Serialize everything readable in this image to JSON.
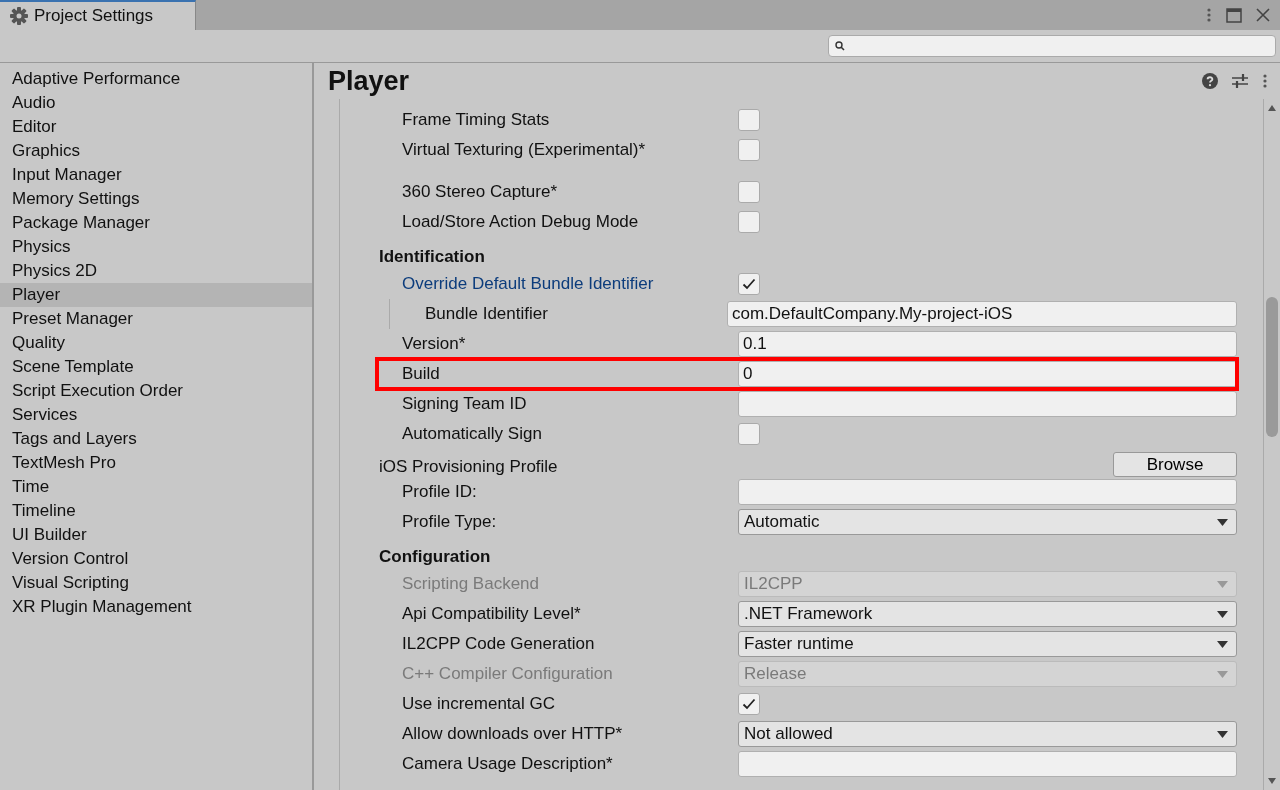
{
  "window": {
    "tab": {
      "title": "Project Settings",
      "selected": true
    }
  },
  "sidebar": {
    "items": [
      {
        "label": "Adaptive Performance",
        "selected": false
      },
      {
        "label": "Audio",
        "selected": false
      },
      {
        "label": "Editor",
        "selected": false
      },
      {
        "label": "Graphics",
        "selected": false
      },
      {
        "label": "Input Manager",
        "selected": false
      },
      {
        "label": "Memory Settings",
        "selected": false
      },
      {
        "label": "Package Manager",
        "selected": false
      },
      {
        "label": "Physics",
        "selected": false
      },
      {
        "label": "Physics 2D",
        "selected": false
      },
      {
        "label": "Player",
        "selected": true
      },
      {
        "label": "Preset Manager",
        "selected": false
      },
      {
        "label": "Quality",
        "selected": false
      },
      {
        "label": "Scene Template",
        "selected": false
      },
      {
        "label": "Script Execution Order",
        "selected": false
      },
      {
        "label": "Services",
        "selected": false
      },
      {
        "label": "Tags and Layers",
        "selected": false
      },
      {
        "label": "TextMesh Pro",
        "selected": false
      },
      {
        "label": "Time",
        "selected": false
      },
      {
        "label": "Timeline",
        "selected": false
      },
      {
        "label": "UI Builder",
        "selected": false
      },
      {
        "label": "Version Control",
        "selected": false
      },
      {
        "label": "Visual Scripting",
        "selected": false
      },
      {
        "label": "XR Plugin Management",
        "selected": false
      }
    ]
  },
  "panel": {
    "title": "Player",
    "rows": [
      {
        "kind": "checkbox",
        "label": "Frame Timing Stats",
        "checked": false
      },
      {
        "kind": "checkbox",
        "label": "Virtual Texturing (Experimental)*",
        "checked": false
      },
      {
        "kind": "spacer"
      },
      {
        "kind": "checkbox",
        "label": "360 Stereo Capture*",
        "checked": false
      },
      {
        "kind": "checkbox",
        "label": "Load/Store Action Debug Mode",
        "checked": false
      },
      {
        "kind": "heading",
        "label": "Identification"
      },
      {
        "kind": "checkbox",
        "label": "Override Default Bundle Identifier",
        "checked": true,
        "overridden": true,
        "children": [
          {
            "kind": "field",
            "label": "Bundle Identifier",
            "value": "com.DefaultCompany.My-project-iOS"
          }
        ]
      },
      {
        "kind": "field",
        "label": "Version*",
        "value": "0.1"
      },
      {
        "kind": "field",
        "label": "Build",
        "value": "0",
        "highlighted": true
      },
      {
        "kind": "field",
        "label": "Signing Team ID"
      },
      {
        "kind": "checkbox",
        "label": "Automatically Sign",
        "checked": false
      },
      {
        "kind": "button",
        "label": "iOS Provisioning Profile",
        "button": "Browse",
        "children": [
          {
            "kind": "field",
            "label": "Profile ID:"
          },
          {
            "kind": "dropdown",
            "label": "Profile Type:",
            "value": "Automatic",
            "disabled": false
          }
        ]
      },
      {
        "kind": "heading",
        "label": "Configuration"
      },
      {
        "kind": "dropdown",
        "label": "Scripting Backend",
        "value": "IL2CPP",
        "disabled": true
      },
      {
        "kind": "dropdown",
        "label": "Api Compatibility Level*",
        "value": ".NET Framework",
        "disabled": false
      },
      {
        "kind": "dropdown",
        "label": "IL2CPP Code Generation",
        "value": "Faster runtime",
        "disabled": false
      },
      {
        "kind": "dropdown",
        "label": "C++ Compiler Configuration",
        "value": "Release",
        "disabled": true
      },
      {
        "kind": "checkbox",
        "label": "Use incremental GC",
        "checked": true
      },
      {
        "kind": "dropdown",
        "label": "Allow downloads over HTTP*",
        "value": "Not allowed",
        "disabled": false
      },
      {
        "kind": "field",
        "label": "Camera Usage Description*"
      }
    ]
  }
}
